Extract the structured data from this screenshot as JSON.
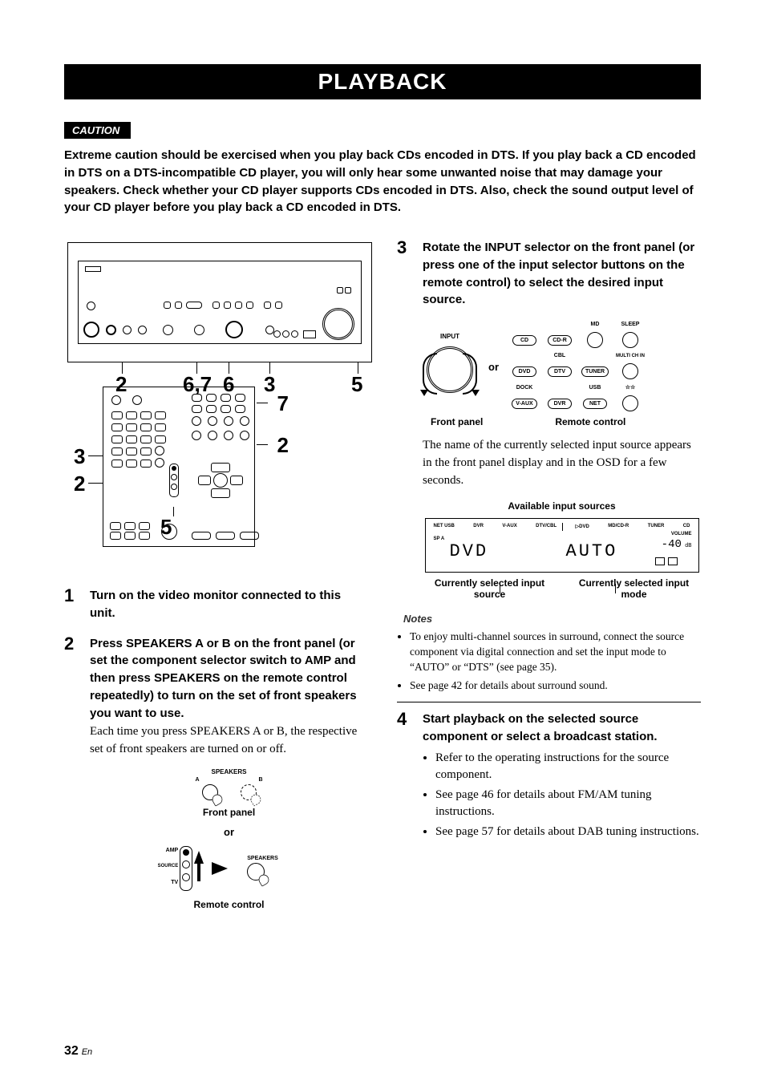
{
  "title": "PLAYBACK",
  "caution_label": "CAUTION",
  "caution_text": "Extreme caution should be exercised when you play back CDs encoded in DTS. If you play back a CD encoded in DTS on a DTS-incompatible CD player, you will only hear some unwanted noise that may damage your speakers. Check whether your CD player supports CDs encoded in DTS. Also, check the sound output level of your CD player before you play back a CD encoded in DTS.",
  "front_panel_callouts": {
    "a": "2",
    "b": "6,7",
    "c": "6",
    "d": "3",
    "e": "5"
  },
  "remote_callouts": {
    "top_right": "7",
    "mid_right": "2",
    "left_upper": "3",
    "left_lower": "2",
    "bottom": "5"
  },
  "steps": {
    "s1": {
      "num": "1",
      "bold": "Turn on the video monitor connected to this unit."
    },
    "s2": {
      "num": "2",
      "bold": "Press SPEAKERS A or B on the front panel (or set the component selector switch to AMP and then press SPEAKERS on the remote control repeatedly) to turn on the set of front speakers you want to use.",
      "plain": "Each time you press SPEAKERS A or B, the respective set of front speakers are turned on or off.",
      "fig": {
        "speakers_label": "SPEAKERS",
        "a": "A",
        "b": "B",
        "front_panel": "Front panel",
        "or": "or",
        "amp": "AMP",
        "source": "SOURCE",
        "tv": "TV",
        "speakers2": "SPEAKERS",
        "remote_control": "Remote control"
      }
    },
    "s3": {
      "num": "3",
      "bold": "Rotate the INPUT selector on the front panel (or press one of the input selector buttons on the remote control) to select the desired input source.",
      "plain": "The name of the currently selected input source appears in the front panel display and in the OSD for a few seconds.",
      "fig": {
        "input_label": "INPUT",
        "or": "or",
        "front_panel": "Front panel",
        "remote_control": "Remote control",
        "btns": {
          "cd": "CD",
          "cdr": "CD-R",
          "md": "MD",
          "sleep": "SLEEP",
          "cbl": "CBL",
          "multi": "MULTI CH IN",
          "dvd": "DVD",
          "dtv": "DTV",
          "tuner": "TUNER",
          "dock": "DOCK",
          "usb": "USB",
          "stars": "☆☆",
          "vaux": "V-AUX",
          "dvr": "DVR",
          "net": "NET"
        }
      },
      "display": {
        "heading": "Available input sources",
        "top_row": [
          "NET USB",
          "DVR",
          "V-AUX",
          "DTV/CBL",
          "▷DVD",
          "MD/CD-R",
          "TUNER",
          "CD"
        ],
        "sp": "SP A",
        "volume_label": "VOLUME",
        "volume_value": "-40",
        "seg_left": "DVD",
        "seg_right": "AUTO",
        "cap_left": "Currently selected input source",
        "cap_right": "Currently selected input mode"
      }
    },
    "s4": {
      "num": "4",
      "bold": "Start playback on the selected source component or select a broadcast station.",
      "bullets": [
        "Refer to the operating instructions for the source component.",
        "See page 46 for details about FM/AM tuning instructions.",
        "See page 57 for details about DAB tuning instructions."
      ]
    }
  },
  "notes_heading": "Notes",
  "notes": [
    "To enjoy multi-channel sources in surround, connect the source component via digital connection and set the input mode to “AUTO” or “DTS” (see page 35).",
    "See page 42 for details about surround sound."
  ],
  "page_number": "32",
  "page_lang": "En"
}
